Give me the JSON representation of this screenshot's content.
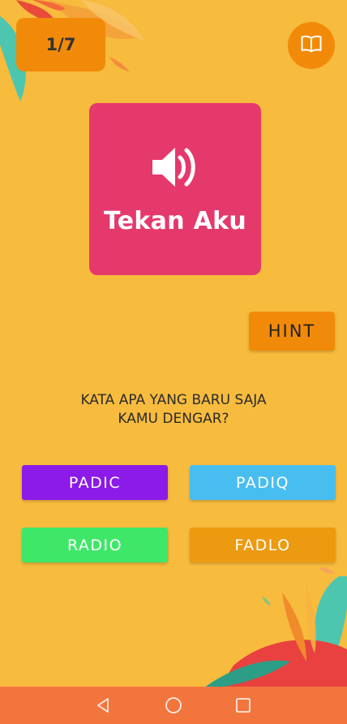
{
  "header": {
    "progress": "1/7"
  },
  "sound_card": {
    "label": "Tekan Aku"
  },
  "hint": {
    "label": "HINT"
  },
  "question": {
    "line1": "KATA APA YANG BARU SAJA",
    "line2": "KAMU DENGAR?"
  },
  "options": [
    {
      "label": "PADIC",
      "color": "#8C1AE8"
    },
    {
      "label": "PADIQ",
      "color": "#47BEEF"
    },
    {
      "label": "RADIO",
      "color": "#3FE768"
    },
    {
      "label": "FADLO",
      "color": "#EC9A10"
    }
  ],
  "colors": {
    "background": "#F7BB3D",
    "accent": "#F28A09",
    "card": "#E5396C",
    "nav_bar": "#F3753E"
  },
  "icons": [
    "book-icon",
    "speaker-icon",
    "nav-back-icon",
    "nav-home-icon",
    "nav-recents-icon"
  ]
}
